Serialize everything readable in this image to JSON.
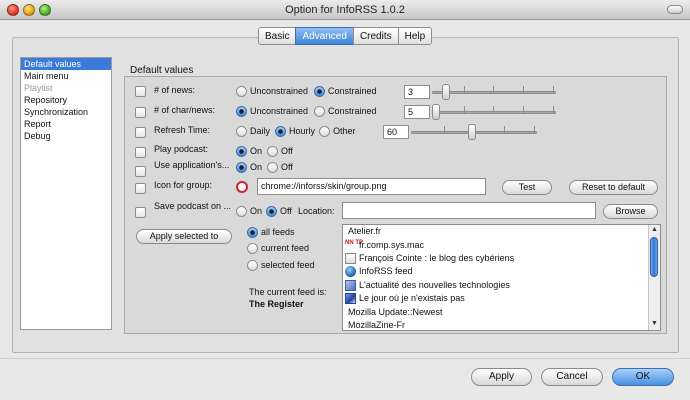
{
  "window": {
    "title": "Option for InfoRSS 1.0.2"
  },
  "tabs": [
    {
      "label": "Basic",
      "active": false
    },
    {
      "label": "Advanced",
      "active": true
    },
    {
      "label": "Credits",
      "active": false
    },
    {
      "label": "Help",
      "active": false
    }
  ],
  "sidebar": {
    "items": [
      {
        "label": "Default values",
        "selected": true
      },
      {
        "label": "Main menu"
      },
      {
        "label": "Playlist",
        "disabled": true
      },
      {
        "label": "Repository"
      },
      {
        "label": "Synchronization"
      },
      {
        "label": "Report"
      },
      {
        "label": "Debug"
      }
    ]
  },
  "panel": {
    "title": "Default values",
    "rows": {
      "news": {
        "label": "# of news:",
        "opt1": "Unconstrained",
        "opt2": "Constrained",
        "selected": "Constrained",
        "value": "3"
      },
      "chars": {
        "label": "# of char/news:",
        "opt1": "Unconstrained",
        "opt2": "Constrained",
        "selected": "Unconstrained",
        "value": "5"
      },
      "refresh": {
        "label": "Refresh Time:",
        "opt1": "Daily",
        "opt2": "Hourly",
        "opt3": "Other",
        "selected": "Hourly",
        "value": "60"
      },
      "podcast": {
        "label": "Play podcast:",
        "opt1": "On",
        "opt2": "Off",
        "selected": "On"
      },
      "useapp": {
        "label": "Use application's...",
        "opt1": "On",
        "opt2": "Off",
        "selected": "On"
      },
      "icon": {
        "label": "Icon for group:",
        "value": "chrome://inforss/skin/group.png",
        "test": "Test",
        "reset": "Reset to default"
      },
      "savepod": {
        "label": "Save podcast on ...",
        "opt1": "On",
        "opt2": "Off",
        "selected": "Off",
        "location_label": "Location:",
        "location_value": "",
        "browse": "Browse"
      }
    },
    "apply_selected": "Apply selected to",
    "scope": {
      "all": "all feeds",
      "current": "current feed",
      "selected": "selected feed",
      "value": "all feeds"
    },
    "current_feed_label": "The current feed is:",
    "current_feed_name": "The Register",
    "feeds": [
      {
        "name": "Atelier.fr",
        "icon": "none"
      },
      {
        "name": "fr.comp.sys.mac",
        "icon": "nntp-icon",
        "icon_text": "NN TP"
      },
      {
        "name": "François Cointe : le blog des cybériens",
        "icon": "page-icon"
      },
      {
        "name": "InfoRSS feed",
        "icon": "globe-icon"
      },
      {
        "name": "L'actualité des nouvelles technologies",
        "icon": "kde-icon"
      },
      {
        "name": "Le jour où je n'existais pas",
        "icon": "art-icon"
      },
      {
        "name": "Mozilla Update::Newest",
        "icon": "none"
      },
      {
        "name": "MozillaZine-Fr",
        "icon": "none"
      }
    ]
  },
  "footer": {
    "apply": "Apply",
    "cancel": "Cancel",
    "ok": "OK"
  },
  "colors": {
    "accent": "#3b7ad8",
    "icon_ring": "#d0202a"
  }
}
